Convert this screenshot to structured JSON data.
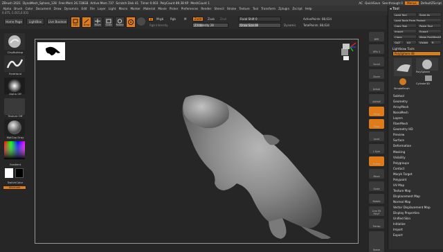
{
  "titlebar": {
    "app": "ZBrush 2021",
    "doc": "DynaMesh_Sphere_128",
    "free_mem": "Free Mem 26.728GB",
    "active_mem": "Active Mem 737",
    "scratch": "Scratch Disk 41",
    "timer": "Timer 0.003",
    "polycount": "PolyCount 89.38 KP",
    "meshcount": "MeshCount 1",
    "ac": "AC",
    "quicksave": "QuickSave",
    "seethrough": "See-through 0",
    "menus": "Menus",
    "script": "DefaultZScript"
  },
  "menubar": [
    "Alpha",
    "Brush",
    "Color",
    "Document",
    "Draw",
    "Dynamics",
    "Edit",
    "File",
    "Layer",
    "Light",
    "Macro",
    "Marker",
    "Material",
    "Movie",
    "Picker",
    "Preferences",
    "Render",
    "Stencil",
    "Stroke",
    "Texture",
    "Tool",
    "Transform",
    "Zplugin",
    "Zscript",
    "Help"
  ],
  "infobar": "0.475,-1.015,0.031",
  "toolshelf": {
    "home": "Home Page",
    "lightbox": "LightBox",
    "live_boolean": "Live Boolean",
    "edit": "Edit",
    "draw": "Draw",
    "move": "Move",
    "scale": "Scale",
    "rotate": "Rotate",
    "a_label": "A",
    "mrgb": "Mrgb",
    "rgb": "Rgb",
    "m": "M",
    "zadd": "Zadd",
    "zsub": "Zsub",
    "zcut": "Zcut",
    "rgb_intensity": "Rgb Intensity",
    "z_intensity": "Z Intensity 28",
    "focal_shift": "Focal Shift 0",
    "draw_size": "Draw Size 88",
    "dynamic": "Dynamic",
    "active_points": "ActivePoints: 88,634",
    "total_points": "TotalPoints: 88,634"
  },
  "leftshelf": {
    "brush": "ClayBuildup",
    "stroke": "FreeHand",
    "alpha": "Alpha Off",
    "texture": "Texture Off",
    "material": "MatCap Gray",
    "gradient": "Gradient",
    "switchcolor": "SwitchColor",
    "alternate": "Alternate"
  },
  "rightshelf": [
    "BPR",
    "SPix 3",
    "Scroll",
    "Zoom",
    "Actual",
    "AAHalf",
    "Persp",
    "Floor",
    "Local",
    "L.Sym",
    "Frame",
    "Move",
    "Scale",
    "Rotate",
    "Line Fill PolyF",
    "Transp",
    "Ghost",
    "Solo",
    "Xpose"
  ],
  "panel": {
    "title": "Tool",
    "buttons": [
      [
        "Load Tool",
        "Save As"
      ],
      [
        "Load Tools From Project"
      ],
      [
        "Copy Tool",
        "Paste Tool"
      ],
      [
        "Import",
        "Export"
      ],
      [
        "Clone",
        "Make PolyMesh3D"
      ],
      [
        "GoZ",
        "All",
        "Visible",
        "R"
      ]
    ],
    "lightbox_tools": "Lightbox▸ Tools",
    "polysphere_slider": "PolySphere 48",
    "tools": [
      "PolySphere",
      "Cylinder3D",
      "SimpleBrush"
    ],
    "subpalettes": [
      "Subtool",
      "Geometry",
      "ArrayMesh",
      "NanoMesh",
      "Layers",
      "FiberMesh",
      "Geometry HD",
      "Preview",
      "Surface",
      "Deformation",
      "Masking",
      "Visibility",
      "Polygroups",
      "Contact",
      "Morph Target",
      "Polypaint",
      "UV Map",
      "Texture Map",
      "Displacement Map",
      "Normal Map",
      "Vector Displacement Map",
      "Display Properties",
      "Unified Skin",
      "Initialize",
      "Import",
      "Export"
    ]
  },
  "colors": {
    "accent": "#e07b1a",
    "bg": "#262626",
    "panel": "#2f2f2f"
  }
}
